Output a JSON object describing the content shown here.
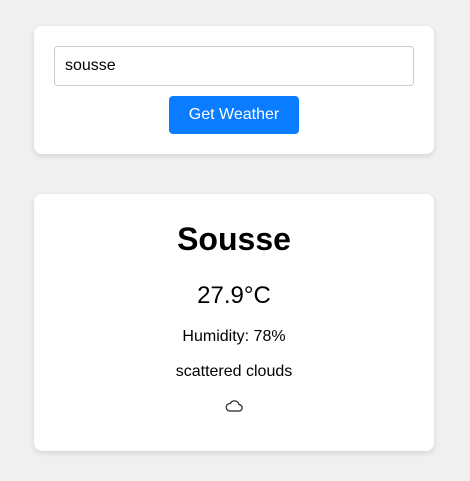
{
  "search": {
    "value": "sousse",
    "button_label": "Get Weather"
  },
  "weather": {
    "city": "Sousse",
    "temperature": "27.9°C",
    "humidity": "Humidity: 78%",
    "description": "scattered clouds",
    "icon": "cloud-icon"
  },
  "colors": {
    "page_background": "#f0f0f0",
    "card_background": "#ffffff",
    "button_background": "#0a7cff",
    "button_text": "#ffffff"
  }
}
